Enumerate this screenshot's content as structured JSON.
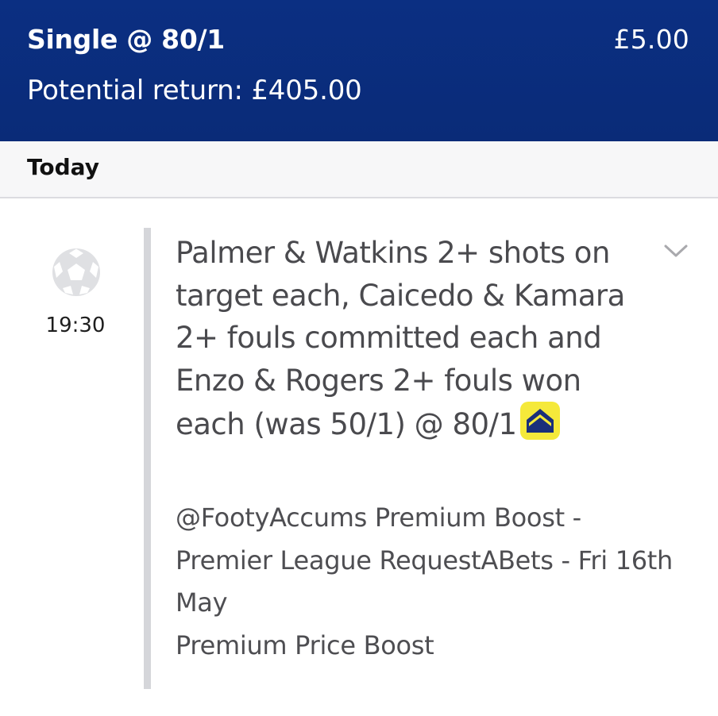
{
  "header": {
    "title": "Single @ 80/1",
    "stake": "£5.00",
    "potential_return": "Potential return: £405.00"
  },
  "day": {
    "label": "Today"
  },
  "event": {
    "sport_icon": "football-icon",
    "time": "19:30",
    "selection_text": "Palmer & Watkins 2+ shots on target each, Caicedo & Kamara 2+ fouls committed each and Enzo & Rogers 2+ fouls won each (was 50/1) @ 80/1",
    "boost_icon": "price-boost-icon",
    "expand_icon": "chevron-down-icon",
    "market": "@FootyAccums Premium Boost - Premier League RequestABets - Fri 16th May",
    "boost_label": "Premium Price Boost"
  },
  "colors": {
    "header_bg": "#0a2b78",
    "boost_yellow": "#f5e93a",
    "boost_navy": "#1a2f7a",
    "divider": "#d5d6da"
  }
}
